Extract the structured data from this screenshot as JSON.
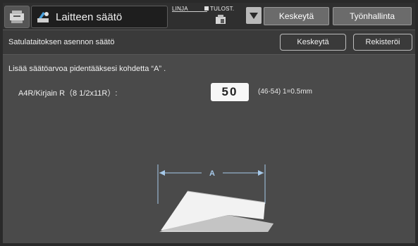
{
  "header": {
    "title": "Laitteen säätö",
    "linja_label": "LINJA",
    "tulost_label": "TULOST.",
    "stop_button": "Keskeytä",
    "job_status_button": "Työnhallinta"
  },
  "subheader": {
    "title": "Satulataitoksen asennon säätö",
    "cancel_button": "Keskeytä",
    "register_button": "Rekisteröi"
  },
  "content": {
    "instruction": "Lisää säätöarvoa pidentääksesi kohdetta “A” .",
    "paper_size_label": "A4R/Kirjain R（8 1/2x11R）:",
    "value": "50",
    "range_text": "(46-54) 1=0.5mm",
    "dimension_label": "A"
  },
  "icons": {
    "home": "home-copier-icon",
    "title": "adjustment-icon",
    "dropdown": "triangle-down-icon",
    "tulost": "printer-icon"
  }
}
